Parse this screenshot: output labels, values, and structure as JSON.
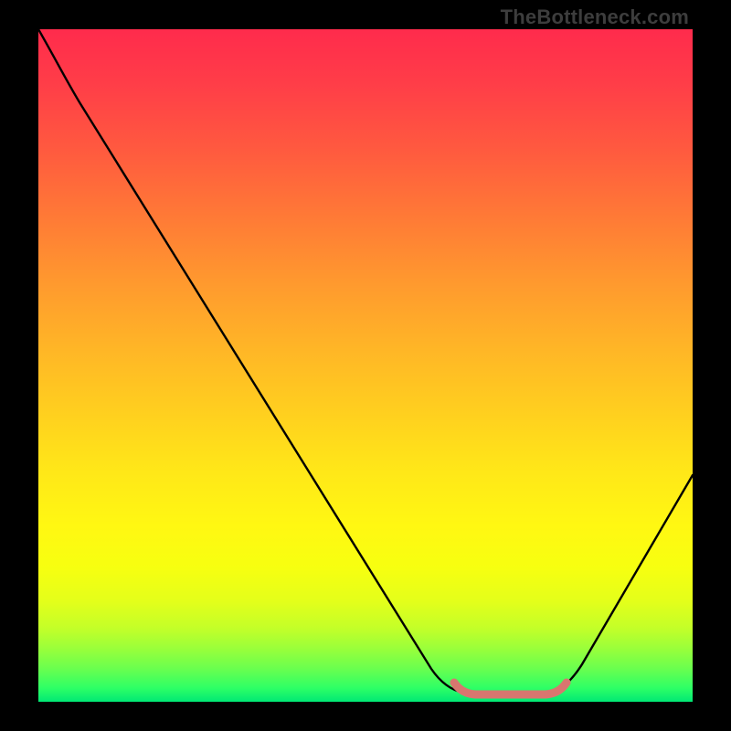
{
  "watermark": "TheBottleneck.com",
  "chart_data": {
    "type": "line",
    "title": "",
    "xlabel": "",
    "ylabel": "",
    "xlim": [
      0,
      100
    ],
    "ylim": [
      0,
      100
    ],
    "grid": false,
    "series": [
      {
        "name": "curve",
        "color": "#000000",
        "x": [
          0,
          4,
          10,
          20,
          30,
          40,
          50,
          58,
          62,
          66,
          70,
          74,
          78,
          80,
          84,
          90,
          96,
          100
        ],
        "y": [
          100,
          96,
          89,
          75,
          61,
          47,
          33,
          21,
          14,
          8,
          3,
          1,
          1,
          1,
          3,
          12,
          24,
          34
        ]
      },
      {
        "name": "bottleneck-band",
        "color": "#d8766f",
        "x": [
          64,
          66,
          70,
          74,
          78,
          80
        ],
        "y": [
          2.5,
          1.2,
          0.8,
          0.8,
          0.8,
          2.5
        ]
      }
    ],
    "gradient_stops": [
      {
        "pos": 0,
        "color": "#ff2b4c"
      },
      {
        "pos": 38,
        "color": "#ff9a2e"
      },
      {
        "pos": 66,
        "color": "#ffe818"
      },
      {
        "pos": 85,
        "color": "#e4ff1a"
      },
      {
        "pos": 100,
        "color": "#00e874"
      }
    ]
  }
}
